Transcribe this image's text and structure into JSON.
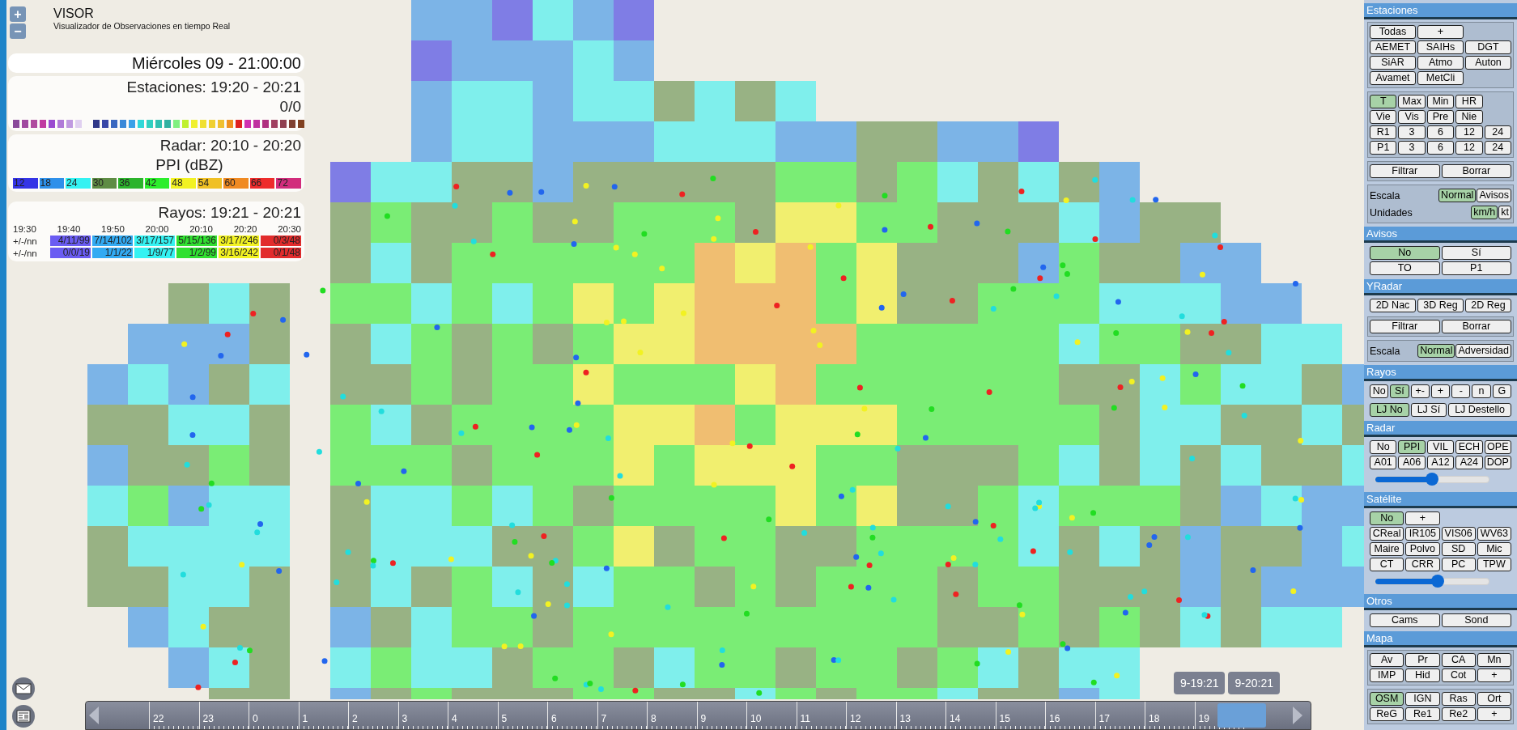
{
  "header": {
    "title": "VISOR",
    "subtitle": "Visualizador de Observaciones en tiempo Real"
  },
  "zoom_controls": [
    "+",
    "−"
  ],
  "datetime": "Miércoles 09 - 21:00:00",
  "stations": {
    "title": "Estaciones: 19:20 - 20:21",
    "count": "0/0"
  },
  "radar": {
    "title": "Radar: 20:10 - 20:20",
    "product": "PPI (dBZ)",
    "scale": [
      {
        "label": "12",
        "color": "#3434e6"
      },
      {
        "label": "18",
        "color": "#2e90ea"
      },
      {
        "label": "24",
        "color": "#34f2f2"
      },
      {
        "label": "30",
        "color": "#5e8c44"
      },
      {
        "label": "36",
        "color": "#2cb42c"
      },
      {
        "label": "42",
        "color": "#2cee2c"
      },
      {
        "label": "48",
        "color": "#f2f222"
      },
      {
        "label": "54",
        "color": "#f0c024"
      },
      {
        "label": "60",
        "color": "#f08a22"
      },
      {
        "label": "66",
        "color": "#ee2c2c"
      },
      {
        "label": "72",
        "color": "#d22c7c"
      }
    ]
  },
  "rayos": {
    "title": "Rayos: 19:21 - 20:21",
    "times": [
      "19:30",
      "19:40",
      "19:50",
      "20:00",
      "20:10",
      "20:20",
      "20:30"
    ],
    "rows": [
      {
        "label": "+/-/nn",
        "cells": [
          {
            "text": "4/11/99",
            "color": "#6a5cf2"
          },
          {
            "text": "7/14/102",
            "color": "#32aaf2"
          },
          {
            "text": "3/17/157",
            "color": "#34f2f2"
          },
          {
            "text": "5/15/136",
            "color": "#30e030"
          },
          {
            "text": "3/17/246",
            "color": "#f2f222"
          },
          {
            "text": "0/3/48",
            "color": "#e22c2c"
          }
        ]
      },
      {
        "label": "+/-/nn",
        "cells": [
          {
            "text": "0/0/19",
            "color": "#6a5cf2"
          },
          {
            "text": "1/1/22",
            "color": "#32aaf2"
          },
          {
            "text": "1/9/77",
            "color": "#34f2f2"
          },
          {
            "text": "1/2/99",
            "color": "#30e030"
          },
          {
            "text": "3/16/242",
            "color": "#f2f222"
          },
          {
            "text": "0/1/48",
            "color": "#e22c2c"
          }
        ]
      }
    ]
  },
  "timeline": {
    "hours": [
      "22",
      "23",
      "0",
      "1",
      "2",
      "3",
      "4",
      "5",
      "6",
      "7",
      "8",
      "9",
      "10",
      "11",
      "12",
      "13",
      "14",
      "15",
      "16",
      "17",
      "18",
      "19"
    ],
    "tooltips": [
      "9-19:21",
      "9-20:21"
    ]
  },
  "sidebar": {
    "sections": [
      {
        "title": "Estaciones",
        "groups": [
          {
            "framed": true,
            "rows": [
              {
                "kind": "buttons",
                "buttons": [
                  {
                    "label": "Todas",
                    "selected": false
                  },
                  {
                    "label": "+",
                    "selected": false
                  }
                ]
              },
              {
                "kind": "buttons",
                "buttons": [
                  {
                    "label": "AEMET",
                    "selected": false
                  },
                  {
                    "label": "SAIHs",
                    "selected": false
                  },
                  {
                    "label": "DGT",
                    "selected": false
                  }
                ]
              },
              {
                "kind": "buttons",
                "buttons": [
                  {
                    "label": "SiAR",
                    "selected": false
                  },
                  {
                    "label": "Atmo",
                    "selected": false
                  },
                  {
                    "label": "Auton",
                    "selected": false
                  }
                ]
              },
              {
                "kind": "buttons",
                "buttons": [
                  {
                    "label": "Avamet",
                    "selected": false
                  },
                  {
                    "label": "MetCli",
                    "selected": false
                  }
                ]
              }
            ]
          },
          {
            "framed": true,
            "rows": [
              {
                "kind": "buttons",
                "buttons": [
                  {
                    "label": "T",
                    "selected": true
                  },
                  {
                    "label": "Max",
                    "selected": false
                  },
                  {
                    "label": "Min",
                    "selected": false
                  },
                  {
                    "label": "HR",
                    "selected": false
                  }
                ]
              },
              {
                "kind": "buttons",
                "buttons": [
                  {
                    "label": "Vie",
                    "selected": false
                  },
                  {
                    "label": "Vis",
                    "selected": false
                  },
                  {
                    "label": "Pre",
                    "selected": false
                  },
                  {
                    "label": "Nie",
                    "selected": false
                  }
                ]
              },
              {
                "kind": "buttons",
                "buttons": [
                  {
                    "label": "R1",
                    "selected": false
                  },
                  {
                    "label": "3",
                    "selected": false
                  },
                  {
                    "label": "6",
                    "selected": false
                  },
                  {
                    "label": "12",
                    "selected": false
                  },
                  {
                    "label": "24",
                    "selected": false
                  }
                ]
              },
              {
                "kind": "buttons",
                "buttons": [
                  {
                    "label": "P1",
                    "selected": false
                  },
                  {
                    "label": "3",
                    "selected": false
                  },
                  {
                    "label": "6",
                    "selected": false
                  },
                  {
                    "label": "12",
                    "selected": false
                  },
                  {
                    "label": "24",
                    "selected": false
                  }
                ]
              }
            ]
          },
          {
            "framed": true,
            "rows": [
              {
                "kind": "buttons",
                "buttons": [
                  {
                    "label": "Filtrar",
                    "selected": false
                  },
                  {
                    "label": "Borrar",
                    "selected": false
                  }
                ]
              }
            ]
          },
          {
            "framed": true,
            "rows": [
              {
                "kind": "labeled",
                "label": "Escala",
                "buttons": [
                  {
                    "label": "Normal",
                    "selected": true
                  },
                  {
                    "label": "Avisos",
                    "selected": false
                  }
                ]
              },
              {
                "kind": "labeled",
                "label": "Unidades",
                "buttons": [
                  {
                    "label": "km/h",
                    "selected": true
                  },
                  {
                    "label": "kt",
                    "selected": false
                  }
                ]
              }
            ]
          }
        ]
      },
      {
        "title": "Avisos",
        "groups": [
          {
            "framed": false,
            "rows": [
              {
                "kind": "buttons",
                "buttons": [
                  {
                    "label": "No",
                    "selected": true
                  },
                  {
                    "label": "Sí",
                    "selected": false
                  }
                ]
              },
              {
                "kind": "buttons",
                "buttons": [
                  {
                    "label": "TO",
                    "selected": false
                  },
                  {
                    "label": "P1",
                    "selected": false
                  }
                ]
              }
            ]
          }
        ]
      },
      {
        "title": "YRadar",
        "groups": [
          {
            "framed": false,
            "rows": [
              {
                "kind": "buttons",
                "buttons": [
                  {
                    "label": "2D Nac",
                    "selected": false
                  },
                  {
                    "label": "3D Reg",
                    "selected": false
                  },
                  {
                    "label": "2D Reg",
                    "selected": false
                  }
                ]
              }
            ]
          },
          {
            "framed": true,
            "rows": [
              {
                "kind": "buttons",
                "buttons": [
                  {
                    "label": "Filtrar",
                    "selected": false
                  },
                  {
                    "label": "Borrar",
                    "selected": false
                  }
                ]
              }
            ]
          },
          {
            "framed": true,
            "rows": [
              {
                "kind": "labeled",
                "label": "Escala",
                "buttons": [
                  {
                    "label": "Normal",
                    "selected": true
                  },
                  {
                    "label": "Adversidad",
                    "selected": false
                  }
                ]
              }
            ]
          }
        ]
      },
      {
        "title": "Rayos",
        "groups": [
          {
            "framed": false,
            "rows": [
              {
                "kind": "buttons",
                "buttons": [
                  {
                    "label": "No",
                    "selected": false
                  },
                  {
                    "label": "Sí",
                    "selected": true
                  },
                  {
                    "label": "+-",
                    "selected": false
                  },
                  {
                    "label": "+",
                    "selected": false
                  },
                  {
                    "label": "-",
                    "selected": false
                  },
                  {
                    "label": "n",
                    "selected": false
                  },
                  {
                    "label": "G",
                    "selected": false
                  }
                ]
              }
            ]
          },
          {
            "framed": false,
            "rows": [
              {
                "kind": "flow",
                "buttons": [
                  {
                    "label": "LJ No",
                    "selected": true
                  },
                  {
                    "label": "LJ Sí",
                    "selected": false
                  },
                  {
                    "label": "LJ Destello",
                    "selected": false
                  }
                ]
              }
            ]
          }
        ]
      },
      {
        "title": "Radar",
        "groups": [
          {
            "framed": false,
            "rows": [
              {
                "kind": "buttons",
                "buttons": [
                  {
                    "label": "No",
                    "selected": false
                  },
                  {
                    "label": "PPI",
                    "selected": true
                  },
                  {
                    "label": "VIL",
                    "selected": false
                  },
                  {
                    "label": "ECH",
                    "selected": false
                  },
                  {
                    "label": "OPE",
                    "selected": false
                  }
                ]
              },
              {
                "kind": "buttons",
                "buttons": [
                  {
                    "label": "A01",
                    "selected": false
                  },
                  {
                    "label": "A06",
                    "selected": false
                  },
                  {
                    "label": "A12",
                    "selected": false
                  },
                  {
                    "label": "A24",
                    "selected": false
                  },
                  {
                    "label": "DOP",
                    "selected": false
                  }
                ]
              },
              {
                "kind": "slider",
                "level": 0.5
              }
            ]
          }
        ]
      },
      {
        "title": "Satélite",
        "groups": [
          {
            "framed": false,
            "rows": [
              {
                "kind": "buttons",
                "buttons": [
                  {
                    "label": "No",
                    "selected": true
                  },
                  {
                    "label": "+",
                    "selected": false
                  }
                ]
              },
              {
                "kind": "buttons",
                "buttons": [
                  {
                    "label": "CReal",
                    "selected": false
                  },
                  {
                    "label": "IR105",
                    "selected": false
                  },
                  {
                    "label": "VIS06",
                    "selected": false
                  },
                  {
                    "label": "WV63",
                    "selected": false
                  }
                ]
              },
              {
                "kind": "buttons",
                "buttons": [
                  {
                    "label": "Maire",
                    "selected": false
                  },
                  {
                    "label": "Polvo",
                    "selected": false
                  },
                  {
                    "label": "SD",
                    "selected": false
                  },
                  {
                    "label": "Mic",
                    "selected": false
                  }
                ]
              },
              {
                "kind": "buttons",
                "buttons": [
                  {
                    "label": "CT",
                    "selected": false
                  },
                  {
                    "label": "CRR",
                    "selected": false
                  },
                  {
                    "label": "PC",
                    "selected": false
                  },
                  {
                    "label": "TPW",
                    "selected": false
                  }
                ]
              },
              {
                "kind": "slider",
                "level": 0.55
              }
            ]
          }
        ]
      },
      {
        "title": "Otros",
        "groups": [
          {
            "framed": false,
            "rows": [
              {
                "kind": "buttons",
                "buttons": [
                  {
                    "label": "Cams",
                    "selected": false
                  },
                  {
                    "label": "Sond",
                    "selected": false
                  }
                ]
              }
            ]
          }
        ]
      },
      {
        "title": "Mapa",
        "groups": [
          {
            "framed": true,
            "rows": [
              {
                "kind": "buttons",
                "buttons": [
                  {
                    "label": "Av",
                    "selected": false
                  },
                  {
                    "label": "Pr",
                    "selected": false
                  },
                  {
                    "label": "CA",
                    "selected": false
                  },
                  {
                    "label": "Mn",
                    "selected": false
                  }
                ]
              },
              {
                "kind": "buttons",
                "buttons": [
                  {
                    "label": "IMP",
                    "selected": false
                  },
                  {
                    "label": "Hid",
                    "selected": false
                  },
                  {
                    "label": "Cot",
                    "selected": false
                  },
                  {
                    "label": "+",
                    "selected": false
                  }
                ]
              }
            ]
          },
          {
            "framed": true,
            "rows": [
              {
                "kind": "buttons",
                "buttons": [
                  {
                    "label": "OSM",
                    "selected": true
                  },
                  {
                    "label": "IGN",
                    "selected": false
                  },
                  {
                    "label": "Ras",
                    "selected": false
                  },
                  {
                    "label": "Ort",
                    "selected": false
                  }
                ]
              },
              {
                "kind": "buttons",
                "buttons": [
                  {
                    "label": "ReG",
                    "selected": false
                  },
                  {
                    "label": "Re1",
                    "selected": false
                  },
                  {
                    "label": "Re2",
                    "selected": false
                  },
                  {
                    "label": "+",
                    "selected": false
                  }
                ]
              }
            ]
          }
        ]
      }
    ]
  }
}
